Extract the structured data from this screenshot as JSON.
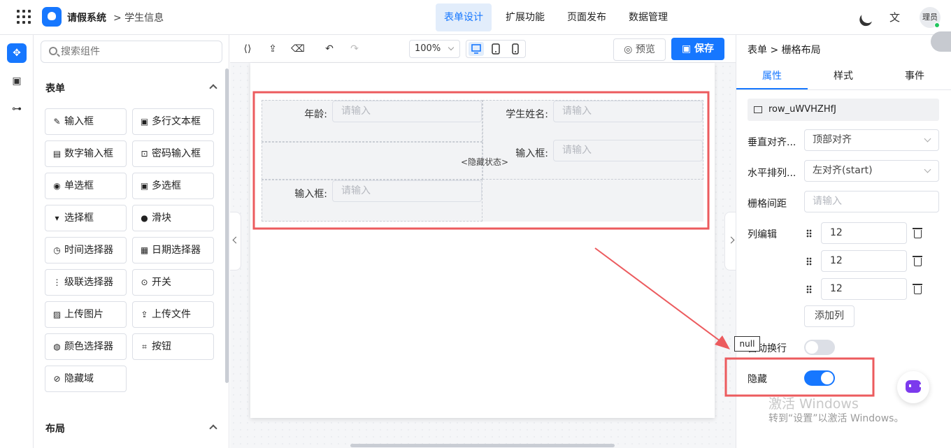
{
  "header": {
    "app_title": "请假系统",
    "breadcrumb": "> 学生信息",
    "tabs": [
      "表单设计",
      "扩展功能",
      "页面发布",
      "数据管理"
    ],
    "active_tab": "表单设计",
    "user": "理员"
  },
  "left_panel": {
    "search_placeholder": "搜索组件",
    "form_section": "表单",
    "components": [
      {
        "label": "输入框",
        "icon": "pencil-icon"
      },
      {
        "label": "多行文本框",
        "icon": "textarea-icon"
      },
      {
        "label": "数字输入框",
        "icon": "number-icon"
      },
      {
        "label": "密码输入框",
        "icon": "lock-icon"
      },
      {
        "label": "单选框",
        "icon": "radio-icon"
      },
      {
        "label": "多选框",
        "icon": "checkbox-icon"
      },
      {
        "label": "选择框",
        "icon": "select-icon"
      },
      {
        "label": "滑块",
        "icon": "slider-icon"
      },
      {
        "label": "时间选择器",
        "icon": "clock-icon"
      },
      {
        "label": "日期选择器",
        "icon": "calendar-icon"
      },
      {
        "label": "级联选择器",
        "icon": "cascader-icon"
      },
      {
        "label": "开关",
        "icon": "switch-icon"
      },
      {
        "label": "上传图片",
        "icon": "image-icon"
      },
      {
        "label": "上传文件",
        "icon": "upload-icon"
      },
      {
        "label": "颜色选择器",
        "icon": "palette-icon"
      },
      {
        "label": "按钮",
        "icon": "button-icon"
      },
      {
        "label": "隐藏域",
        "icon": "eye-off-icon"
      }
    ],
    "layout_section": "布局"
  },
  "toolbar": {
    "zoom": "100%",
    "preview_label": "预览",
    "save_label": "保存"
  },
  "canvas": {
    "fields": [
      {
        "label": "年龄:",
        "placeholder": "请输入"
      },
      {
        "label": "学生姓名:",
        "placeholder": "请输入"
      },
      {
        "label": "输入框:",
        "placeholder": "请输入"
      },
      {
        "label": "输入框:",
        "placeholder": "请输入"
      }
    ],
    "hidden_tag": "<隐藏状态>"
  },
  "right_panel": {
    "breadcrumb_form": "表单",
    "breadcrumb_sep": ">",
    "breadcrumb_current": "栅格布局",
    "tabs": [
      "属性",
      "样式",
      "事件"
    ],
    "active_tab": "属性",
    "component_id": "row_uWVHZHfJ",
    "vertical_align_label": "垂直对齐...",
    "vertical_align_value": "顶部对齐",
    "horizontal_label": "水平排列...",
    "horizontal_value": "左对齐(start)",
    "gutter_label": "栅格间距",
    "gutter_placeholder": "请输入",
    "columns_label": "列编辑",
    "columns": [
      "12",
      "12",
      "12"
    ],
    "add_column_label": "添加列",
    "wrap_label": "自动换行",
    "wrap_on": false,
    "hidden_label": "隐藏",
    "hidden_on": true
  },
  "tooltip": "null",
  "watermark": {
    "line1": "激活 Windows",
    "line2": "转到“设置”以激活 Windows。"
  },
  "colors": {
    "accent": "#1677ff",
    "highlight": "#ec5b5e"
  }
}
